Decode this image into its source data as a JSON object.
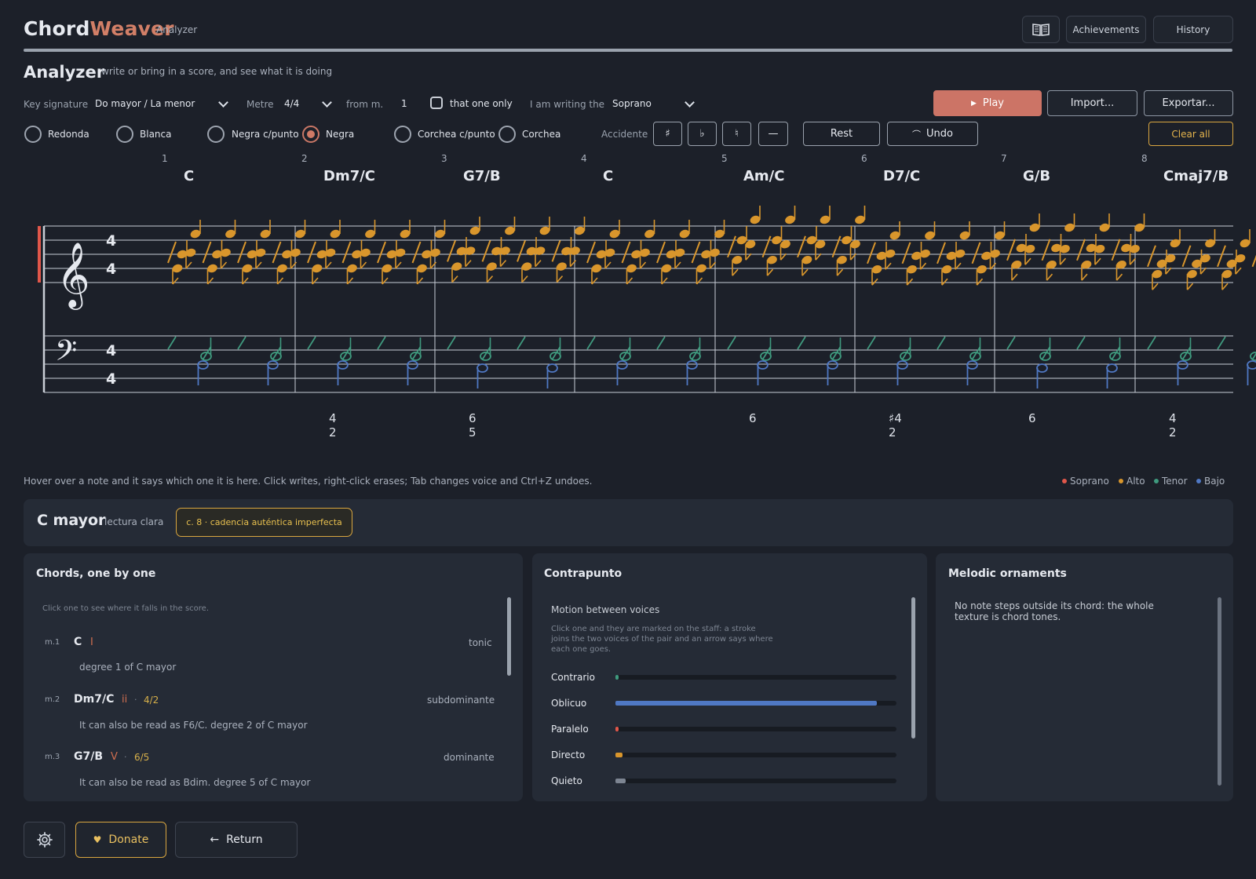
{
  "header": {
    "brand_part1": "Chord",
    "brand_part2": "Weaver",
    "brand_sub": "Analyzer",
    "book_icon": "book-icon",
    "achievements": "Achievements",
    "history": "History"
  },
  "page": {
    "title": "Analyzer",
    "subtitle": "write or bring in a score, and see what it is doing"
  },
  "controls": {
    "key_label": "Key signature",
    "key_value": "Do mayor / La menor",
    "metre_label": "Metre",
    "metre_value": "4/4",
    "from_label": "from m.",
    "from_value": "1",
    "only_label": "that one only",
    "writing_label": "I am writing the",
    "voice_value": "Soprano",
    "play": "Play",
    "import": "Import...",
    "export": "Exportar..."
  },
  "durations": [
    "Redonda",
    "Blanca",
    "Negra c/punto",
    "Negra",
    "Corchea c/punto",
    "Corchea"
  ],
  "duration_selected": "Negra",
  "accidents": {
    "label": "Accidente",
    "sharp": "♯",
    "flat": "♭",
    "natural": "♮",
    "none": "—"
  },
  "actions": {
    "rest": "Rest",
    "undo": "Undo",
    "clear": "Clear all"
  },
  "score": {
    "clef_treble": "𝄞",
    "clef_bass": "𝄢",
    "time_top": "4",
    "time_bottom": "4",
    "measures": [
      {
        "num": "1",
        "chord": "C",
        "fig_top": "",
        "fig_bottom": ""
      },
      {
        "num": "2",
        "chord": "Dm7/C",
        "fig_top": "4",
        "fig_bottom": "2"
      },
      {
        "num": "3",
        "chord": "G7/B",
        "fig_top": "6",
        "fig_bottom": "5"
      },
      {
        "num": "4",
        "chord": "C",
        "fig_top": "",
        "fig_bottom": ""
      },
      {
        "num": "5",
        "chord": "Am/C",
        "fig_top": "6",
        "fig_bottom": ""
      },
      {
        "num": "6",
        "chord": "D7/C",
        "fig_top": "♯4",
        "fig_bottom": "2"
      },
      {
        "num": "7",
        "chord": "G/B",
        "fig_top": "6",
        "fig_bottom": ""
      },
      {
        "num": "8",
        "chord": "Cmaj7/B",
        "fig_top": "4",
        "fig_bottom": "2"
      }
    ]
  },
  "hint": "Hover over a note and it says which one it is here. Click writes, right-click erases; Tab changes voice and Ctrl+Z undoes.",
  "voices": [
    {
      "name": "Soprano",
      "color": "#e0574a"
    },
    {
      "name": "Alto",
      "color": "#d9962c"
    },
    {
      "name": "Tenor",
      "color": "#3f9a7e"
    },
    {
      "name": "Bajo",
      "color": "#4f78c4"
    }
  ],
  "key_result": {
    "name": "C mayor",
    "reading": "lectura clara",
    "cadence": "c. 8  ·  cadencia auténtica imperfecta"
  },
  "chords_panel": {
    "title": "Chords, one by one",
    "hint": "Click one to see where it falls in the score.",
    "items": [
      {
        "m": "m.1",
        "name": "C",
        "roman": "I",
        "figure": "",
        "function": "tonic",
        "desc": "degree 1 of C mayor"
      },
      {
        "m": "m.2",
        "name": "Dm7/C",
        "roman": "ii",
        "figure": "4/2",
        "function": "subdominante",
        "desc": "It can also be read as F6/C. degree 2 of C mayor"
      },
      {
        "m": "m.3",
        "name": "G7/B",
        "roman": "V",
        "figure": "6/5",
        "function": "dominante",
        "desc": "It can also be read as Bdim. degree 5 of C mayor"
      }
    ]
  },
  "counterpoint": {
    "title": "Contrapunto",
    "subtitle": "Motion between voices",
    "hint_lines": [
      "Click one and they are marked on the staff: a stroke",
      "joins the two voices of the pair and an arrow says where",
      "each one goes."
    ],
    "motions": [
      {
        "label": "Contrario",
        "fraction": 0.01,
        "color": "#3f9a7e"
      },
      {
        "label": "Oblicuo",
        "fraction": 0.93,
        "color": "#4f78c4"
      },
      {
        "label": "Paralelo",
        "fraction": 0.005,
        "color": "#e0574a"
      },
      {
        "label": "Directo",
        "fraction": 0.025,
        "color": "#d9962c"
      },
      {
        "label": "Quieto",
        "fraction": 0.035,
        "color": "#7d8592"
      }
    ]
  },
  "ornaments": {
    "title": "Melodic ornaments",
    "text_line1": "No note steps outside its chord: the whole",
    "text_line2": "texture is chord tones."
  },
  "footer": {
    "settings_icon": "gear-icon",
    "donate": "Donate",
    "return": "Return"
  }
}
